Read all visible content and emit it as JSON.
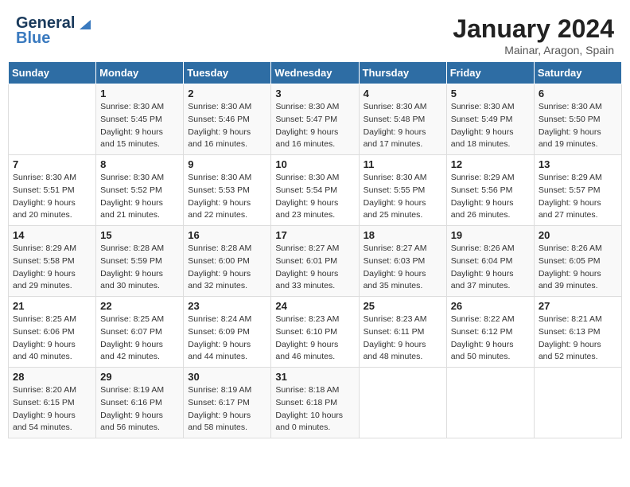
{
  "header": {
    "logo_general": "General",
    "logo_blue": "Blue",
    "title": "January 2024",
    "subtitle": "Mainar, Aragon, Spain"
  },
  "weekdays": [
    "Sunday",
    "Monday",
    "Tuesday",
    "Wednesday",
    "Thursday",
    "Friday",
    "Saturday"
  ],
  "weeks": [
    [
      {
        "day": "",
        "sunrise": "",
        "sunset": "",
        "daylight": ""
      },
      {
        "day": "1",
        "sunrise": "Sunrise: 8:30 AM",
        "sunset": "Sunset: 5:45 PM",
        "daylight": "Daylight: 9 hours and 15 minutes."
      },
      {
        "day": "2",
        "sunrise": "Sunrise: 8:30 AM",
        "sunset": "Sunset: 5:46 PM",
        "daylight": "Daylight: 9 hours and 16 minutes."
      },
      {
        "day": "3",
        "sunrise": "Sunrise: 8:30 AM",
        "sunset": "Sunset: 5:47 PM",
        "daylight": "Daylight: 9 hours and 16 minutes."
      },
      {
        "day": "4",
        "sunrise": "Sunrise: 8:30 AM",
        "sunset": "Sunset: 5:48 PM",
        "daylight": "Daylight: 9 hours and 17 minutes."
      },
      {
        "day": "5",
        "sunrise": "Sunrise: 8:30 AM",
        "sunset": "Sunset: 5:49 PM",
        "daylight": "Daylight: 9 hours and 18 minutes."
      },
      {
        "day": "6",
        "sunrise": "Sunrise: 8:30 AM",
        "sunset": "Sunset: 5:50 PM",
        "daylight": "Daylight: 9 hours and 19 minutes."
      }
    ],
    [
      {
        "day": "7",
        "sunrise": "Sunrise: 8:30 AM",
        "sunset": "Sunset: 5:51 PM",
        "daylight": "Daylight: 9 hours and 20 minutes."
      },
      {
        "day": "8",
        "sunrise": "Sunrise: 8:30 AM",
        "sunset": "Sunset: 5:52 PM",
        "daylight": "Daylight: 9 hours and 21 minutes."
      },
      {
        "day": "9",
        "sunrise": "Sunrise: 8:30 AM",
        "sunset": "Sunset: 5:53 PM",
        "daylight": "Daylight: 9 hours and 22 minutes."
      },
      {
        "day": "10",
        "sunrise": "Sunrise: 8:30 AM",
        "sunset": "Sunset: 5:54 PM",
        "daylight": "Daylight: 9 hours and 23 minutes."
      },
      {
        "day": "11",
        "sunrise": "Sunrise: 8:30 AM",
        "sunset": "Sunset: 5:55 PM",
        "daylight": "Daylight: 9 hours and 25 minutes."
      },
      {
        "day": "12",
        "sunrise": "Sunrise: 8:29 AM",
        "sunset": "Sunset: 5:56 PM",
        "daylight": "Daylight: 9 hours and 26 minutes."
      },
      {
        "day": "13",
        "sunrise": "Sunrise: 8:29 AM",
        "sunset": "Sunset: 5:57 PM",
        "daylight": "Daylight: 9 hours and 27 minutes."
      }
    ],
    [
      {
        "day": "14",
        "sunrise": "Sunrise: 8:29 AM",
        "sunset": "Sunset: 5:58 PM",
        "daylight": "Daylight: 9 hours and 29 minutes."
      },
      {
        "day": "15",
        "sunrise": "Sunrise: 8:28 AM",
        "sunset": "Sunset: 5:59 PM",
        "daylight": "Daylight: 9 hours and 30 minutes."
      },
      {
        "day": "16",
        "sunrise": "Sunrise: 8:28 AM",
        "sunset": "Sunset: 6:00 PM",
        "daylight": "Daylight: 9 hours and 32 minutes."
      },
      {
        "day": "17",
        "sunrise": "Sunrise: 8:27 AM",
        "sunset": "Sunset: 6:01 PM",
        "daylight": "Daylight: 9 hours and 33 minutes."
      },
      {
        "day": "18",
        "sunrise": "Sunrise: 8:27 AM",
        "sunset": "Sunset: 6:03 PM",
        "daylight": "Daylight: 9 hours and 35 minutes."
      },
      {
        "day": "19",
        "sunrise": "Sunrise: 8:26 AM",
        "sunset": "Sunset: 6:04 PM",
        "daylight": "Daylight: 9 hours and 37 minutes."
      },
      {
        "day": "20",
        "sunrise": "Sunrise: 8:26 AM",
        "sunset": "Sunset: 6:05 PM",
        "daylight": "Daylight: 9 hours and 39 minutes."
      }
    ],
    [
      {
        "day": "21",
        "sunrise": "Sunrise: 8:25 AM",
        "sunset": "Sunset: 6:06 PM",
        "daylight": "Daylight: 9 hours and 40 minutes."
      },
      {
        "day": "22",
        "sunrise": "Sunrise: 8:25 AM",
        "sunset": "Sunset: 6:07 PM",
        "daylight": "Daylight: 9 hours and 42 minutes."
      },
      {
        "day": "23",
        "sunrise": "Sunrise: 8:24 AM",
        "sunset": "Sunset: 6:09 PM",
        "daylight": "Daylight: 9 hours and 44 minutes."
      },
      {
        "day": "24",
        "sunrise": "Sunrise: 8:23 AM",
        "sunset": "Sunset: 6:10 PM",
        "daylight": "Daylight: 9 hours and 46 minutes."
      },
      {
        "day": "25",
        "sunrise": "Sunrise: 8:23 AM",
        "sunset": "Sunset: 6:11 PM",
        "daylight": "Daylight: 9 hours and 48 minutes."
      },
      {
        "day": "26",
        "sunrise": "Sunrise: 8:22 AM",
        "sunset": "Sunset: 6:12 PM",
        "daylight": "Daylight: 9 hours and 50 minutes."
      },
      {
        "day": "27",
        "sunrise": "Sunrise: 8:21 AM",
        "sunset": "Sunset: 6:13 PM",
        "daylight": "Daylight: 9 hours and 52 minutes."
      }
    ],
    [
      {
        "day": "28",
        "sunrise": "Sunrise: 8:20 AM",
        "sunset": "Sunset: 6:15 PM",
        "daylight": "Daylight: 9 hours and 54 minutes."
      },
      {
        "day": "29",
        "sunrise": "Sunrise: 8:19 AM",
        "sunset": "Sunset: 6:16 PM",
        "daylight": "Daylight: 9 hours and 56 minutes."
      },
      {
        "day": "30",
        "sunrise": "Sunrise: 8:19 AM",
        "sunset": "Sunset: 6:17 PM",
        "daylight": "Daylight: 9 hours and 58 minutes."
      },
      {
        "day": "31",
        "sunrise": "Sunrise: 8:18 AM",
        "sunset": "Sunset: 6:18 PM",
        "daylight": "Daylight: 10 hours and 0 minutes."
      },
      {
        "day": "",
        "sunrise": "",
        "sunset": "",
        "daylight": ""
      },
      {
        "day": "",
        "sunrise": "",
        "sunset": "",
        "daylight": ""
      },
      {
        "day": "",
        "sunrise": "",
        "sunset": "",
        "daylight": ""
      }
    ]
  ]
}
